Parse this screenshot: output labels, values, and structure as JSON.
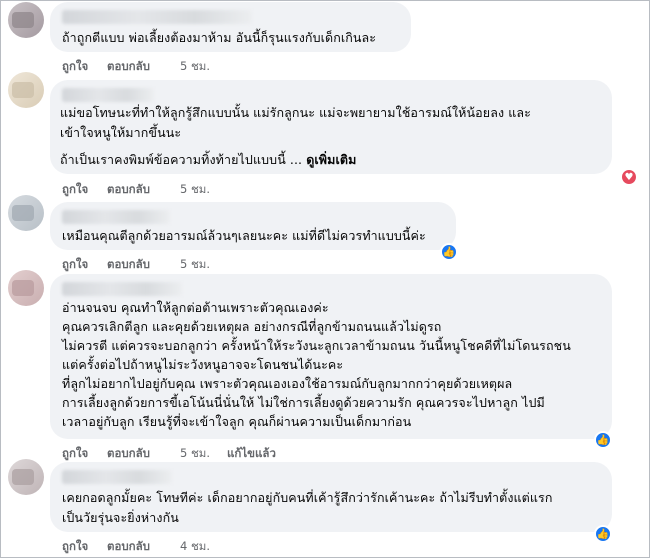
{
  "actions": {
    "like_label": "ถูกใจ",
    "reply_label": "ตอบกลับ",
    "edited_label": "แก้ไขแล้ว",
    "see_more_label": "ดูเพิ่มเติม"
  },
  "comments": [
    {
      "lines": [
        "ถ้าถูกตีแบบ พ่อเลี้ยงต้องมาห้าม อันนี้ก็รุนแรงกับเด็กเกินละ"
      ],
      "time": "5 ชม.",
      "reaction": "none"
    },
    {
      "lines": [
        "แม่ขอโทษนะที่ทำให้ลูกรู้สึกแบบนั้น แม่รักลูกนะ แม่จะพยายามใช้อารมณ์ให้น้อยลง และ",
        "เข้าใจหนูให้มากขึ้นนะ"
      ],
      "truncated_line": "ถ้าเป็นเราคงพิมพ์ข้อความทิ้งท้ายไปแบบนี้ ...",
      "time": "5 ชม.",
      "reaction": "love"
    },
    {
      "lines": [
        "เหมือนคุณตีลูกด้วยอารมณ์ล้วนๆเลยนะคะ แม่ที่ดีไม่ควรทำแบบนี้ค่ะ"
      ],
      "time": "5 ชม.",
      "reaction": "like"
    },
    {
      "lines": [
        "อ่านจนจบ คุณทำให้ลูกต่อต้านเพราะตัวคุณเองค่ะ",
        "คุณควรเลิกตีลูก และคุยด้วยเหตุผล อย่างกรณีที่ลูกข้ามถนนแล้วไม่ดูรถ",
        "ไม่ควรตี แต่ควรจะบอกลูกว่า ครั้งหน้าให้ระวังนะลูกเวลาข้ามถนน วันนี้หนูโชคดีที่ไม่โดนรถชน",
        "แต่ครั้งต่อไปถ้าหนูไม่ระวังหนูอาจจะโดนชนได้นะคะ",
        "ที่ลูกไม่อยากไปอยู่กับคุณ เพราะตัวคุณเองเองใช้อารมณ์กับลูกมากกว่าคุยด้วยเหตุผล",
        "การเลี้ยงลูกด้วยการขี้เอโน้นนี่นั่นให้ ไม่ใช่การเลี้ยงดูด้วยความรัก คุณควรจะไปหาลูก ไปมี",
        "เวลาอยู่กับลูก เรียนรู้ที่จะเข้าใจลูก คุณก็ผ่านความเป็นเด็กมาก่อน"
      ],
      "time": "5 ชม.",
      "edited": true,
      "reaction": "like"
    },
    {
      "lines": [
        "เคยกอดลูกมั้ยคะ โทษทีค่ะ เด็กอยากอยู่กับคนที่เค้ารู้สึกว่ารักเค้านะคะ ถ้าไม่รีบทำตั้งแต่แรก",
        "เป็นวัยรุ่นจะยิ่งห่างกัน"
      ],
      "time": "4 ชม.",
      "reaction": "like"
    }
  ],
  "colors": {
    "bubble": "#f0f2f5",
    "text": "#050505",
    "meta": "#65676b",
    "like": "#1877f2",
    "love": "#e64a5e"
  }
}
